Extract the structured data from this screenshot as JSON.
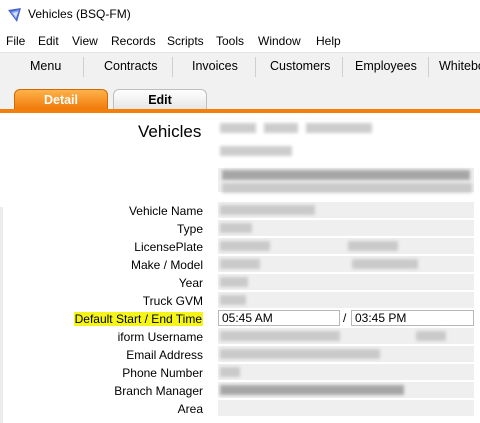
{
  "window": {
    "title": "Vehicles (BSQ-FM)",
    "icon": "filemaker-icon"
  },
  "menu": [
    "File",
    "Edit",
    "View",
    "Records",
    "Scripts",
    "Tools",
    "Window",
    "Help"
  ],
  "nav": [
    "Menu",
    "Contracts",
    "Invoices",
    "Customers",
    "Employees",
    "Whiteboard"
  ],
  "tabs": {
    "detail": "Detail",
    "edit": "Edit"
  },
  "header": {
    "title": "Vehicles"
  },
  "fields": {
    "vehicle_name": "Vehicle Name",
    "type": "Type",
    "license_plate": "LicensePlate",
    "make_model": "Make / Model",
    "year": "Year",
    "truck_gvm": "Truck GVM",
    "default_time": "Default Start / End Time",
    "iform_username": "iform Username",
    "email": "Email Address",
    "phone": "Phone Number",
    "branch_manager": "Branch Manager",
    "area": "Area"
  },
  "times": {
    "start": "05:45 AM",
    "separator": "/",
    "end": "03:45 PM"
  },
  "colors": {
    "tab_active": "#f07b0b",
    "highlight": "#f5f51a"
  }
}
